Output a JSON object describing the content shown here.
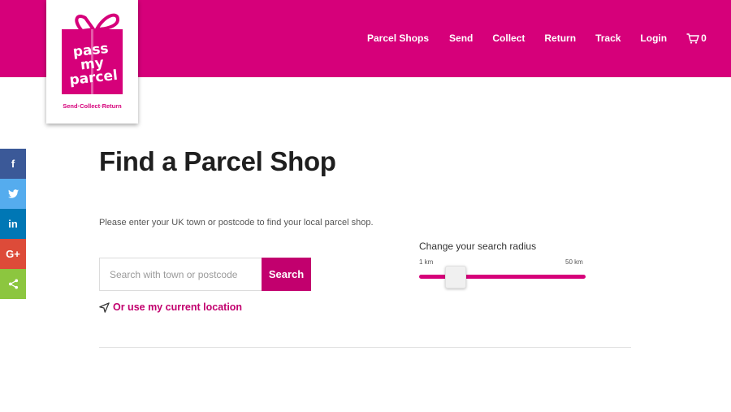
{
  "brand": {
    "logo_lines": [
      "pass",
      "my",
      "parcel"
    ],
    "tagline": "Send·Collect·Return",
    "color": "#d6007a"
  },
  "nav": {
    "items": [
      {
        "label": "Parcel Shops"
      },
      {
        "label": "Send"
      },
      {
        "label": "Collect"
      },
      {
        "label": "Return"
      },
      {
        "label": "Track"
      },
      {
        "label": "Login"
      }
    ],
    "cart_count": "0",
    "cart_icon": "cart-icon"
  },
  "social": [
    {
      "name": "facebook",
      "glyph": "f",
      "color": "#3b5998"
    },
    {
      "name": "twitter",
      "icon": "twitter-bird-icon",
      "color": "#55acee"
    },
    {
      "name": "linkedin",
      "glyph": "in",
      "color": "#0077b5"
    },
    {
      "name": "google-plus",
      "glyph": "G+",
      "color": "#dd4b39"
    },
    {
      "name": "share",
      "icon": "share-icon",
      "color": "#8cc63f"
    }
  ],
  "main": {
    "title": "Find a Parcel Shop",
    "intro": "Please enter your UK town or postcode to find your local parcel shop.",
    "search": {
      "placeholder": "Search with town or postcode",
      "value": "",
      "button_label": "Search"
    },
    "location_link": "Or use my current location"
  },
  "radius": {
    "label": "Change your search radius",
    "min_label": "1 km",
    "max_label": "50 km",
    "fraction": 0.22
  }
}
